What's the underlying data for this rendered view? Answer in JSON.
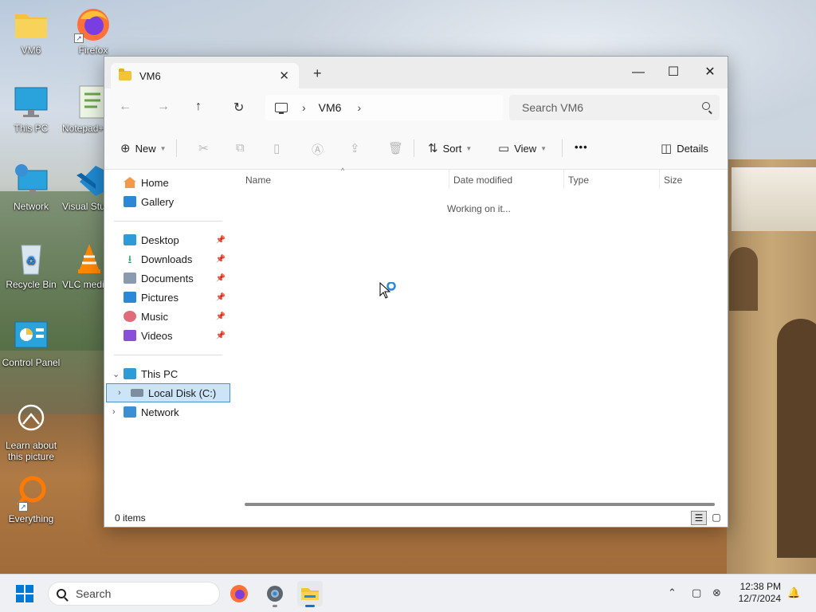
{
  "desktop": {
    "icons": [
      {
        "label": "VM6"
      },
      {
        "label": "Firefox"
      },
      {
        "label": "This PC"
      },
      {
        "label": "Notepad++"
      },
      {
        "label": "Network"
      },
      {
        "label": "Visual Studio Code"
      },
      {
        "label": "Recycle Bin"
      },
      {
        "label": "VLC media player"
      },
      {
        "label": "Control Panel"
      },
      {
        "label": "Learn about this picture"
      },
      {
        "label": "Everything"
      }
    ]
  },
  "window": {
    "tab_title": "VM6",
    "tab_close": "✕",
    "new_tab": "+",
    "controls": {
      "minimize": "—",
      "maximize": "☐",
      "close": "✕"
    },
    "address": {
      "segments": [
        "VM6"
      ]
    },
    "search": {
      "placeholder": "Search VM6"
    },
    "toolbar": {
      "new_label": "New",
      "sort_label": "Sort",
      "view_label": "View",
      "more_label": "•••",
      "details_label": "Details"
    },
    "nav": {
      "home": "Home",
      "gallery": "Gallery",
      "quick": [
        {
          "label": "Desktop"
        },
        {
          "label": "Downloads"
        },
        {
          "label": "Documents"
        },
        {
          "label": "Pictures"
        },
        {
          "label": "Music"
        },
        {
          "label": "Videos"
        }
      ],
      "this_pc": "This PC",
      "local_disk": "Local Disk (C:)",
      "network": "Network"
    },
    "columns": [
      "Name",
      "Date modified",
      "Type",
      "Size"
    ],
    "working_text": "Working on it...",
    "status": {
      "item_count": "0 items"
    }
  },
  "taskbar": {
    "search_placeholder": "Search",
    "time": "12:38 PM",
    "date": "12/7/2024"
  },
  "colors": {
    "accent": "#0078d4",
    "selection": "#cce4f7",
    "folder": "#f3c33a"
  }
}
